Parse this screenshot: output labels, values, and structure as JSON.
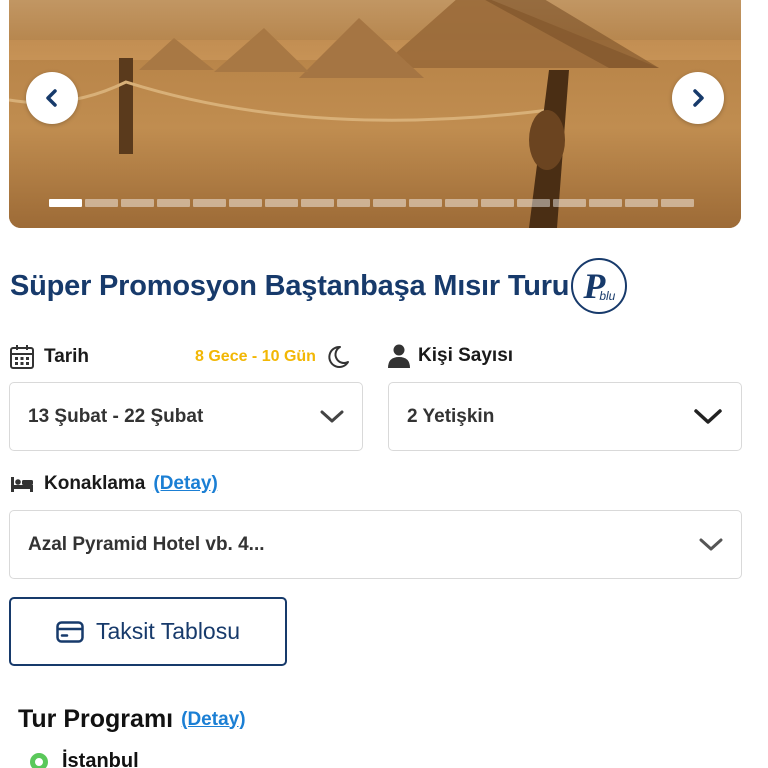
{
  "hero": {
    "slide_count": 18,
    "active_slide": 0,
    "prev_icon": "chevron-left-icon",
    "next_icon": "chevron-right-icon"
  },
  "tour": {
    "title": "Süper Promosyon Baştanbaşa Mısır Turu",
    "badge_letter": "P",
    "badge_text": "blu"
  },
  "date": {
    "label": "Tarih",
    "icon": "calendar-icon",
    "duration": "8 Gece - 10 Gün",
    "duration_icon": "moon-icon",
    "value": "13 Şubat - 22 Şubat"
  },
  "persons": {
    "label": "Kişi Sayısı",
    "icon": "person-icon",
    "value": "2 Yetişkin"
  },
  "accommodation": {
    "label": "Konaklama",
    "icon": "bed-icon",
    "detail_link": "(Detay)",
    "value": "Azal Pyramid Hotel vb. 4..."
  },
  "installment_button": {
    "label": "Taksit Tablosu",
    "icon": "credit-card-icon"
  },
  "program": {
    "title": "Tur Programı",
    "detail_link": "(Detay)",
    "stops": [
      "İstanbul"
    ]
  },
  "colors": {
    "brand_navy": "#173a6b",
    "link_blue": "#1b7fd4",
    "accent_yellow": "#f2b705",
    "pin_green": "#5ac85a"
  }
}
